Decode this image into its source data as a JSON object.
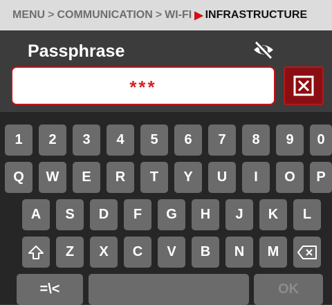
{
  "breadcrumb": {
    "items": [
      "MENU",
      "COMMUNICATION",
      "WI-FI",
      "INFRASTRUCTURE"
    ],
    "separator": ">"
  },
  "field": {
    "title": "Passphrase",
    "value": "***",
    "visibility_icon": "eye-slash-icon",
    "clear_icon": "clear-x-icon"
  },
  "keyboard": {
    "row1": [
      "1",
      "2",
      "3",
      "4",
      "5",
      "6",
      "7",
      "8",
      "9",
      "0"
    ],
    "row2": [
      "Q",
      "W",
      "E",
      "R",
      "T",
      "Y",
      "U",
      "I",
      "O",
      "P"
    ],
    "row3": [
      "A",
      "S",
      "D",
      "F",
      "G",
      "H",
      "J",
      "K",
      "L"
    ],
    "row4": [
      "Z",
      "X",
      "C",
      "V",
      "B",
      "N",
      "M"
    ],
    "shift_icon": "shift-arrow-icon",
    "backspace_icon": "backspace-icon",
    "symbols_label": "=\\<",
    "space_label": "",
    "ok_label": "OK"
  },
  "colors": {
    "accent": "#d10f14",
    "breadcrumb_bg": "#dcdcdc",
    "panel_bg": "#3c3c3c",
    "keyboard_bg": "#262626",
    "key_bg": "#6b6b6b"
  }
}
